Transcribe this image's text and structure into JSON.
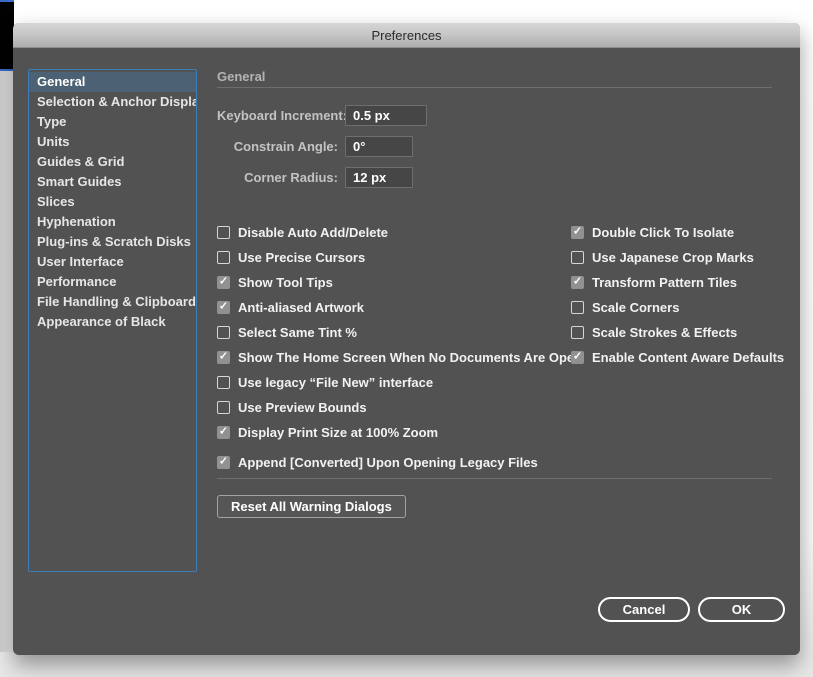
{
  "ui": {
    "check_glyph": "✓"
  },
  "colors": {
    "panel": "#525252",
    "accent_blue_border": "#3d7db8",
    "sidebar_selection": "#4c6173",
    "checkbox_checked_fill": "#919191",
    "strip_accent_blue": "#3a6bc8",
    "titlebar_text": "#2b2b2b"
  },
  "dialog": {
    "title": "Preferences",
    "section_title": "General",
    "sidebar": {
      "items": [
        {
          "label": "General",
          "selected": true
        },
        {
          "label": "Selection & Anchor Display",
          "selected": false
        },
        {
          "label": "Type",
          "selected": false
        },
        {
          "label": "Units",
          "selected": false
        },
        {
          "label": "Guides & Grid",
          "selected": false
        },
        {
          "label": "Smart Guides",
          "selected": false
        },
        {
          "label": "Slices",
          "selected": false
        },
        {
          "label": "Hyphenation",
          "selected": false
        },
        {
          "label": "Plug-ins & Scratch Disks",
          "selected": false
        },
        {
          "label": "User Interface",
          "selected": false
        },
        {
          "label": "Performance",
          "selected": false
        },
        {
          "label": "File Handling & Clipboard",
          "selected": false
        },
        {
          "label": "Appearance of Black",
          "selected": false
        }
      ]
    },
    "fields": [
      {
        "label": "Keyboard Increment:",
        "value": "0.5 px"
      },
      {
        "label": "Constrain Angle:",
        "value": "0°"
      },
      {
        "label": "Corner Radius:",
        "value": "12 px"
      }
    ],
    "checkboxes": {
      "left": [
        {
          "label": "Disable Auto Add/Delete",
          "checked": false
        },
        {
          "label": "Use Precise Cursors",
          "checked": false
        },
        {
          "label": "Show Tool Tips",
          "checked": true
        },
        {
          "label": "Anti-aliased Artwork",
          "checked": true
        },
        {
          "label": "Select Same Tint %",
          "checked": false
        },
        {
          "label": "Show The Home Screen When No Documents Are Open",
          "checked": true
        },
        {
          "label": "Use legacy “File New” interface",
          "checked": false
        },
        {
          "label": "Use Preview Bounds",
          "checked": false
        },
        {
          "label": "Display Print Size at 100% Zoom",
          "checked": true
        },
        {
          "label": "Append [Converted] Upon Opening Legacy Files",
          "checked": true
        }
      ],
      "right": [
        {
          "label": "Double Click To Isolate",
          "checked": true
        },
        {
          "label": "Use Japanese Crop Marks",
          "checked": false
        },
        {
          "label": "Transform Pattern Tiles",
          "checked": true
        },
        {
          "label": "Scale Corners",
          "checked": false
        },
        {
          "label": "Scale Strokes & Effects",
          "checked": false
        },
        {
          "label": "Enable Content Aware Defaults",
          "checked": true
        }
      ]
    },
    "buttons": {
      "reset": "Reset All Warning Dialogs",
      "cancel": "Cancel",
      "ok": "OK"
    }
  }
}
